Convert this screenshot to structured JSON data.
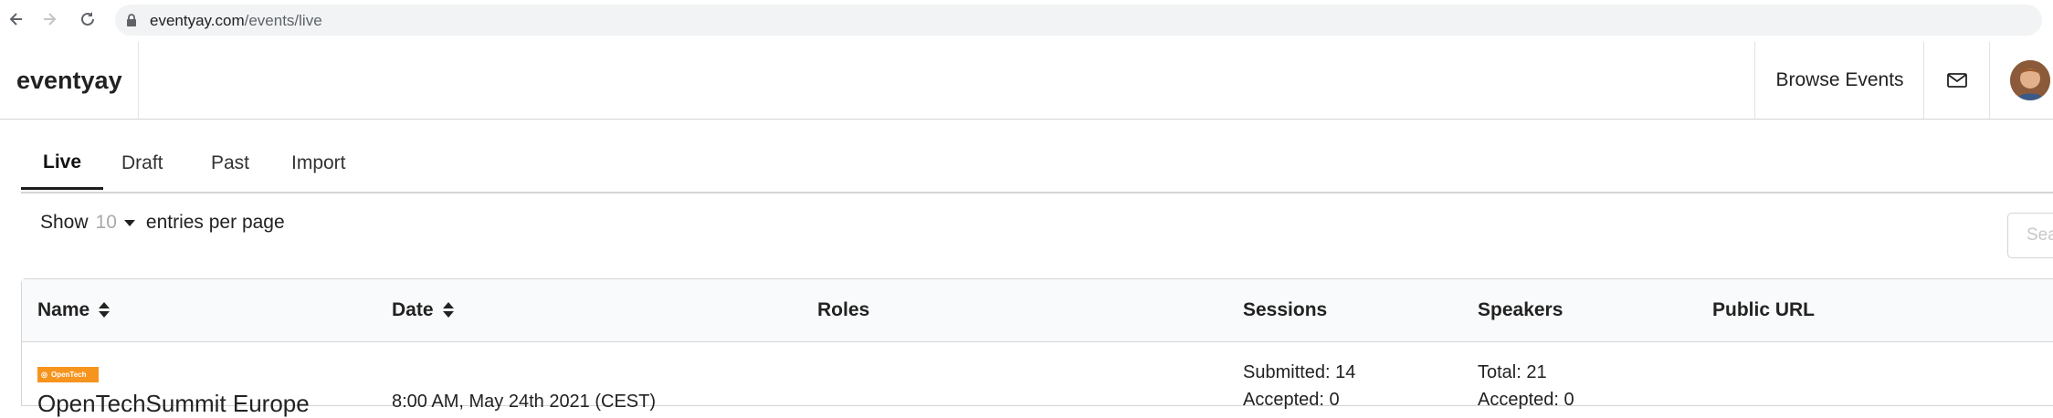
{
  "browser": {
    "url_host": "eventyay.com",
    "url_path": "/events/live"
  },
  "app": {
    "brand": "eventyay",
    "browse_events": "Browse Events"
  },
  "tabs": [
    {
      "label": "Live",
      "active": true
    },
    {
      "label": "Draft",
      "active": false
    },
    {
      "label": "Past",
      "active": false
    },
    {
      "label": "Import",
      "active": false
    }
  ],
  "entries": {
    "show": "Show",
    "count": "10",
    "suffix": "entries per page"
  },
  "search": {
    "placeholder": "Search"
  },
  "table": {
    "columns": [
      {
        "label": "Name",
        "sortable": true
      },
      {
        "label": "Date",
        "sortable": true
      },
      {
        "label": "Roles",
        "sortable": false
      },
      {
        "label": "Sessions",
        "sortable": false
      },
      {
        "label": "Speakers",
        "sortable": false
      },
      {
        "label": "Public URL",
        "sortable": false
      }
    ],
    "rows": [
      {
        "logo_text": "OpenTech",
        "name": "OpenTechSummit Europe",
        "date": "8:00 AM, May 24th 2021 (CEST)",
        "sessions_submitted": "Submitted: 14",
        "sessions_accepted": "Accepted: 0",
        "speakers_total": "Total: 21",
        "speakers_accepted": "Accepted: 0"
      }
    ]
  },
  "colors": {
    "brand_logo": "#f7941d",
    "header_bg": "#f9fafb",
    "border": "#d4d4d5"
  }
}
